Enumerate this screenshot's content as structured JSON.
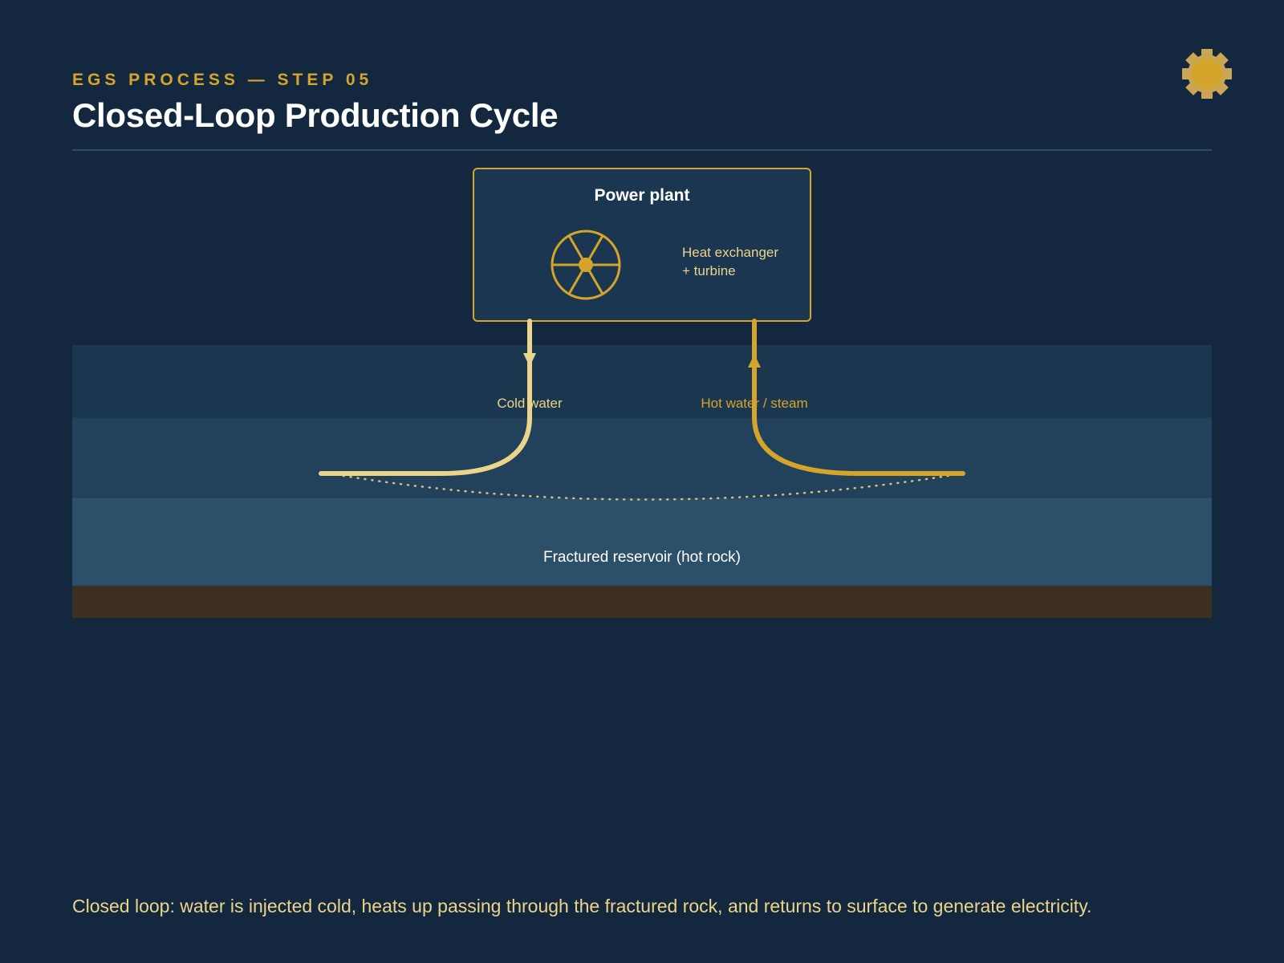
{
  "header": {
    "kicker": "EGS PROCESS — STEP 05",
    "title": "Closed-Loop Production Cycle"
  },
  "plant": {
    "title": "Power plant",
    "detail_line1": "Heat exchanger",
    "detail_line2": "+ turbine"
  },
  "flows": {
    "cold_label": "Cold water",
    "hot_label": "Hot water / steam"
  },
  "reservoir": {
    "label": "Fractured reservoir (hot rock)"
  },
  "caption": "Closed loop: water is injected cold, heats up passing through the fractured rock, and returns to surface to generate electricity.",
  "colors": {
    "background": "#13283e",
    "accent_gold": "#d4a52a",
    "cold_pipe": "#ecd48a",
    "hot_pipe": "#d4a52a",
    "text_light": "#ffffff"
  },
  "icons": {
    "logo": "gear-icon",
    "turbine": "turbine-wheel-icon"
  }
}
